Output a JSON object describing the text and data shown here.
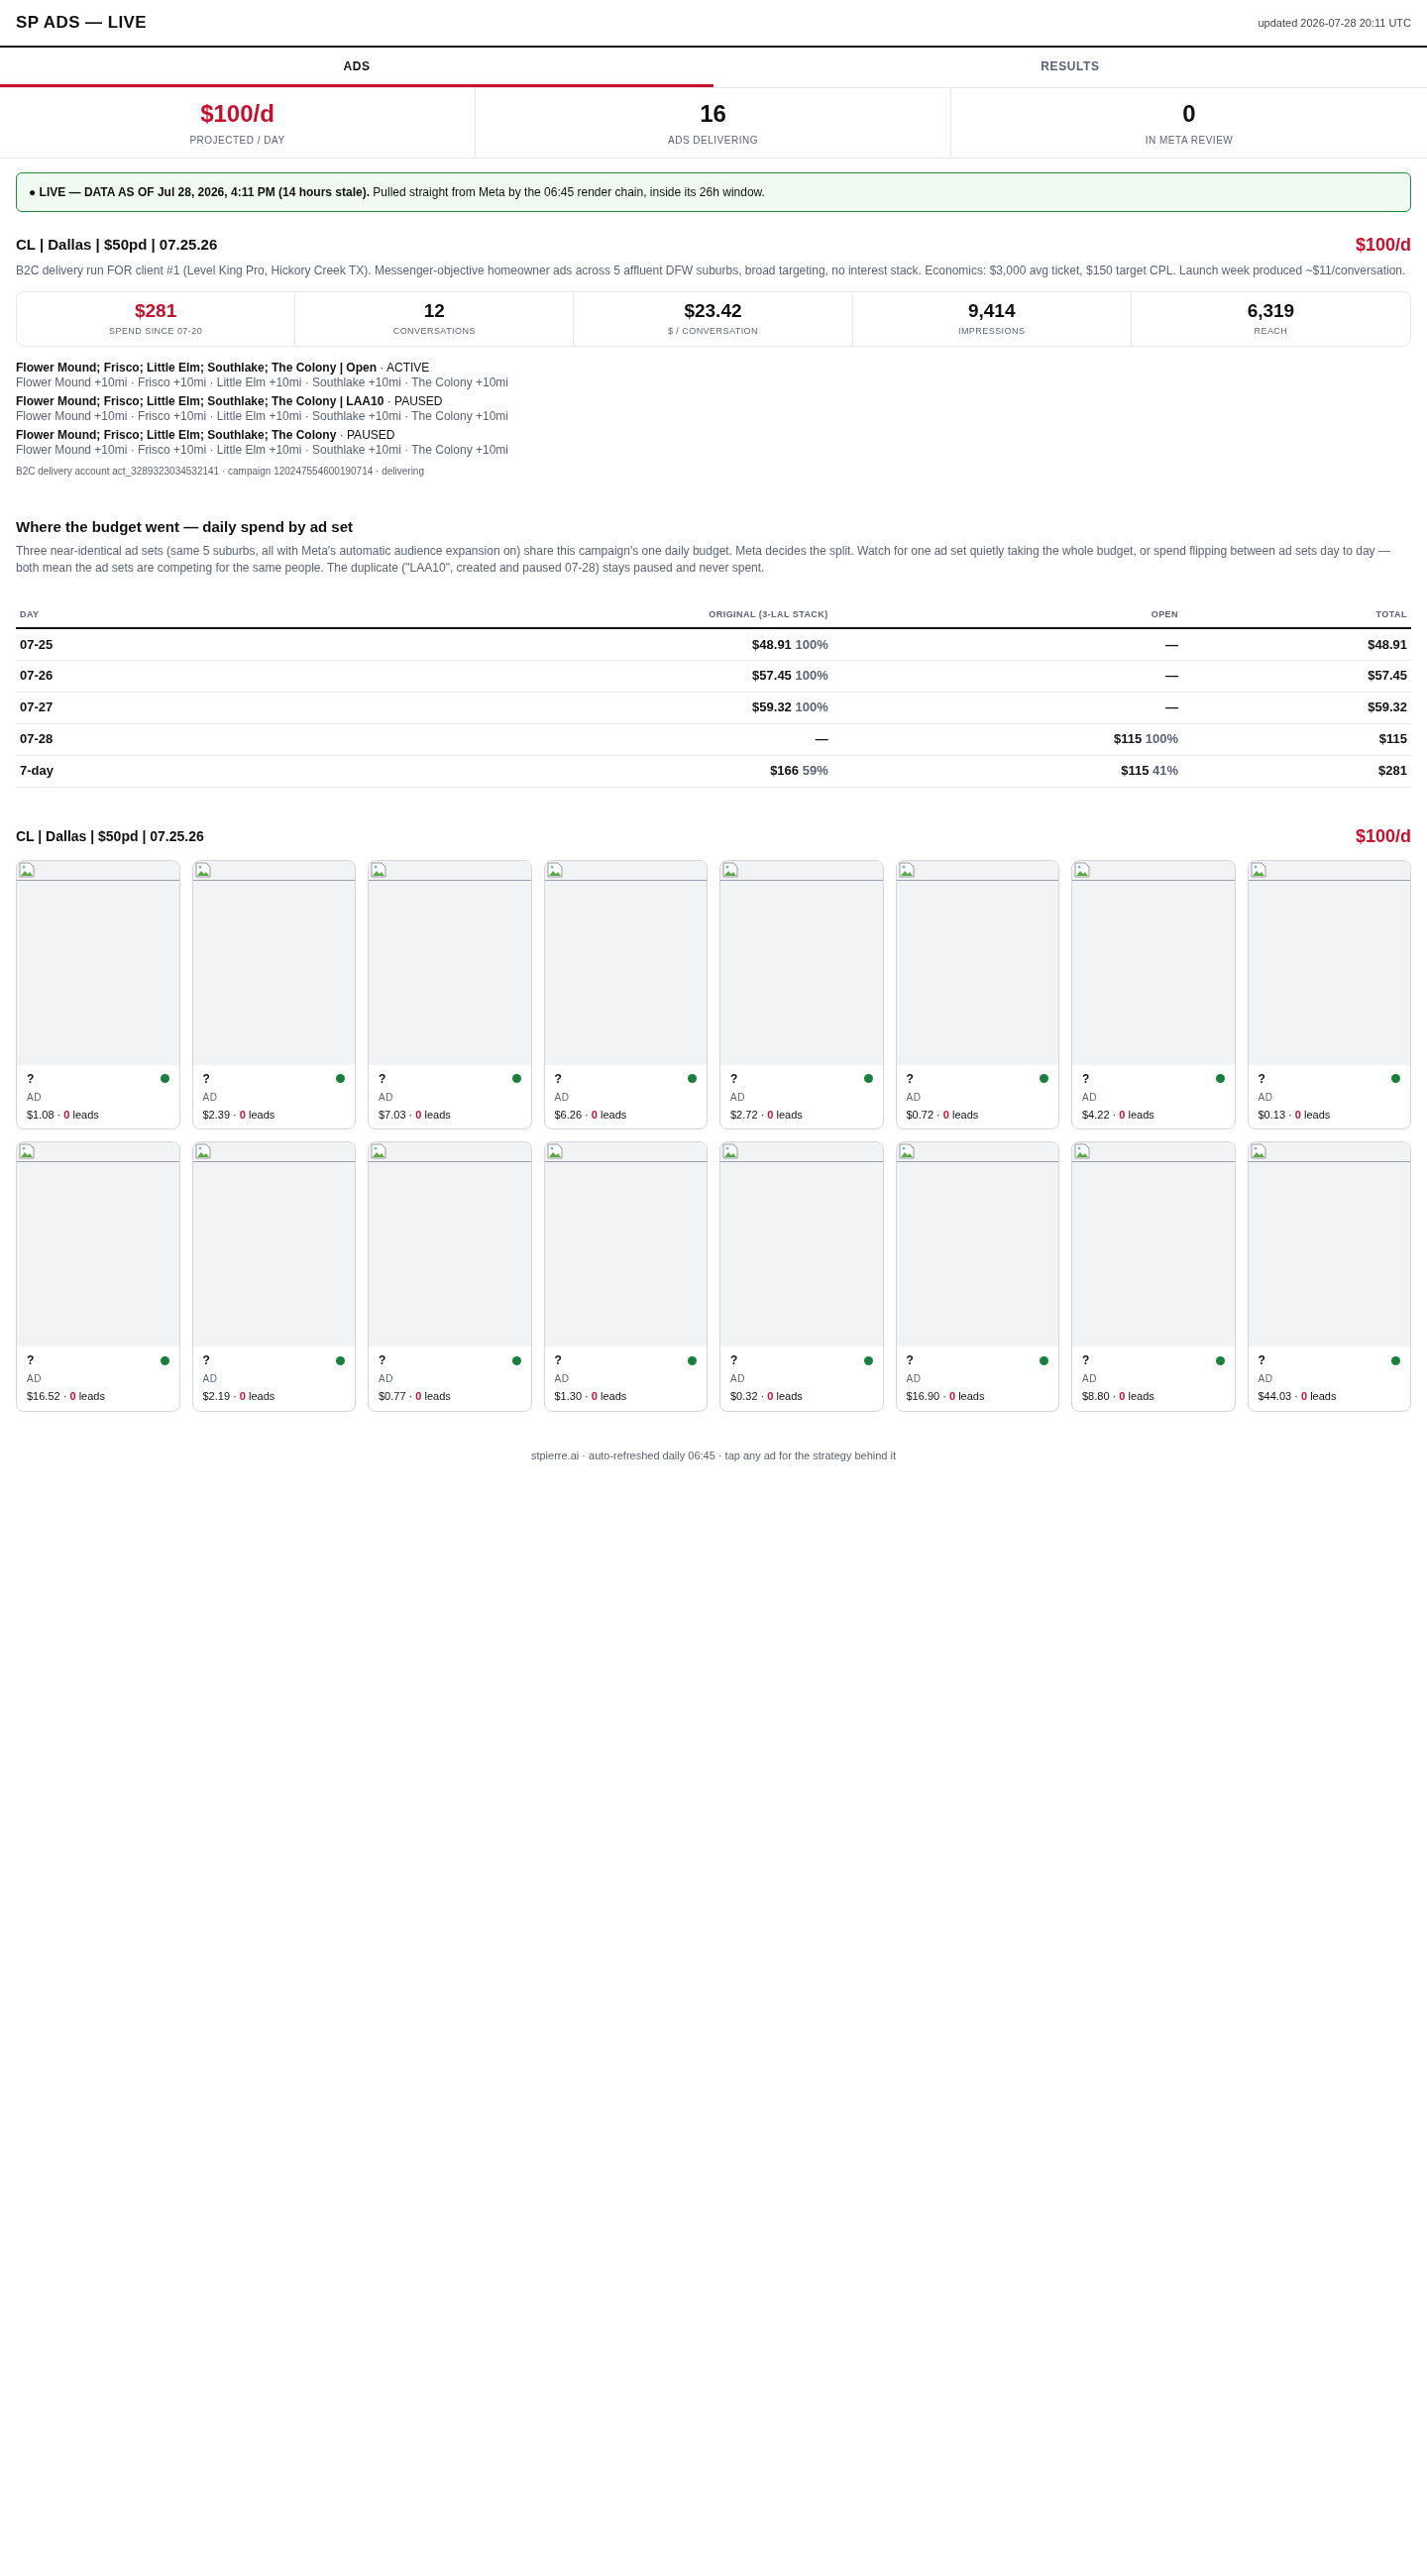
{
  "header": {
    "title": "SP ADS — LIVE",
    "updated": "updated 2026-07-28 20:11 UTC"
  },
  "tabs": [
    {
      "label": "ADS",
      "selected": true
    },
    {
      "label": "RESULTS",
      "selected": false
    }
  ],
  "summary": [
    {
      "value": "$100/d",
      "label": "PROJECTED / DAY",
      "highlight": true
    },
    {
      "value": "16",
      "label": "ADS DELIVERING",
      "highlight": false
    },
    {
      "value": "0",
      "label": "IN META REVIEW",
      "highlight": false
    }
  ],
  "banner": {
    "text": "**● LIVE — DATA AS OF Jul 28, 2026, 4:11 PM (14 hours stale).** Pulled straight from Meta by the 06:45 render chain, inside its 26h window."
  },
  "campaign": {
    "name": "CL | Dallas | $50pd | 07.25.26",
    "budget": "$100/d",
    "description": "B2C delivery run FOR client #1 (Level King Pro, Hickory Creek TX). Messenger-objective homeowner ads across 5 affluent DFW suburbs, broad targeting, no interest stack. Economics: $3,000 avg ticket, $150 target CPL. Launch week produced ~$11/conversation.",
    "stats": [
      {
        "value": "$281",
        "label": "SPEND SINCE 07-20",
        "highlight": true
      },
      {
        "value": "12",
        "label": "CONVERSATIONS",
        "highlight": false
      },
      {
        "value": "$23.42",
        "label": "$ / CONVERSATION",
        "highlight": false
      },
      {
        "value": "9,414",
        "label": "IMPRESSIONS",
        "highlight": false
      },
      {
        "value": "6,319",
        "label": "REACH",
        "highlight": false
      }
    ],
    "ad_sets": [
      {
        "name": "**Flower Mound; Frisco; Little Elm; Southlake; The Colony | Open** · ACTIVE",
        "geo": "Flower Mound +10mi · Frisco +10mi · Little Elm +10mi · Southlake +10mi · The Colony +10mi"
      },
      {
        "name": "**Flower Mound; Frisco; Little Elm; Southlake; The Colony | LAA10** · PAUSED",
        "geo": "Flower Mound +10mi · Frisco +10mi · Little Elm +10mi · Southlake +10mi · The Colony +10mi"
      },
      {
        "name": "**Flower Mound; Frisco; Little Elm; Southlake; The Colony** · PAUSED",
        "geo": "Flower Mound +10mi · Frisco +10mi · Little Elm +10mi · Southlake +10mi · The Colony +10mi"
      }
    ],
    "account": "B2C delivery account act_3289323034532141 · campaign 120247554600190714 · delivering"
  },
  "budget": {
    "title": "Where the budget went — daily spend by ad set",
    "description": "Three near-identical ad sets (same 5 suburbs, all with Meta's automatic audience expansion on) share this campaign's one daily budget. Meta decides the split. Watch for one ad set quietly taking the whole budget, or spend flipping between ad sets day to day — both mean the ad sets are competing for the same people. The duplicate (\"LAA10\", created and paused 07-28) stays paused and never spent.",
    "columns": [
      "DAY",
      "ORIGINAL (3-LAL STACK)",
      "OPEN",
      "TOTAL"
    ],
    "rows": [
      [
        {
          "amount": "07-25"
        },
        {
          "amount": "$48.91",
          "share": "100%"
        },
        {
          "amount": "—"
        },
        {
          "amount": "$48.91"
        }
      ],
      [
        {
          "amount": "07-26"
        },
        {
          "amount": "$57.45",
          "share": "100%"
        },
        {
          "amount": "—"
        },
        {
          "amount": "$57.45"
        }
      ],
      [
        {
          "amount": "07-27"
        },
        {
          "amount": "$59.32",
          "share": "100%"
        },
        {
          "amount": "—"
        },
        {
          "amount": "$59.32"
        }
      ],
      [
        {
          "amount": "07-28"
        },
        {
          "amount": "—"
        },
        {
          "amount": "$115",
          "share": "100%"
        },
        {
          "amount": "$115"
        }
      ],
      [
        {
          "amount": "7-day"
        },
        {
          "amount": "$166",
          "share": "59%"
        },
        {
          "amount": "$115",
          "share": "41%"
        },
        {
          "amount": "$281"
        }
      ]
    ]
  },
  "ads_section": {
    "name": "CL | Dallas | $50pd | 07.25.26",
    "budget": "$100/d",
    "ads": [
      {
        "title": "?",
        "type": "AD",
        "spend": "$1.08 ·",
        "leads": "0",
        "unit": "leads",
        "active": true
      },
      {
        "title": "?",
        "type": "AD",
        "spend": "$2.39 ·",
        "leads": "0",
        "unit": "leads",
        "active": true
      },
      {
        "title": "?",
        "type": "AD",
        "spend": "$7.03 ·",
        "leads": "0",
        "unit": "leads",
        "active": true
      },
      {
        "title": "?",
        "type": "AD",
        "spend": "$6.26 ·",
        "leads": "0",
        "unit": "leads",
        "active": true
      },
      {
        "title": "?",
        "type": "AD",
        "spend": "$2.72 ·",
        "leads": "0",
        "unit": "leads",
        "active": true
      },
      {
        "title": "?",
        "type": "AD",
        "spend": "$0.72 ·",
        "leads": "0",
        "unit": "leads",
        "active": true
      },
      {
        "title": "?",
        "type": "AD",
        "spend": "$4.22 ·",
        "leads": "0",
        "unit": "leads",
        "active": true
      },
      {
        "title": "?",
        "type": "AD",
        "spend": "$0.13 ·",
        "leads": "0",
        "unit": "leads",
        "active": true
      },
      {
        "title": "?",
        "type": "AD",
        "spend": "$16.52 ·",
        "leads": "0",
        "unit": "leads",
        "active": true
      },
      {
        "title": "?",
        "type": "AD",
        "spend": "$2.19 ·",
        "leads": "0",
        "unit": "leads",
        "active": true
      },
      {
        "title": "?",
        "type": "AD",
        "spend": "$0.77 ·",
        "leads": "0",
        "unit": "leads",
        "active": true
      },
      {
        "title": "?",
        "type": "AD",
        "spend": "$1.30 ·",
        "leads": "0",
        "unit": "leads",
        "active": true
      },
      {
        "title": "?",
        "type": "AD",
        "spend": "$0.32 ·",
        "leads": "0",
        "unit": "leads",
        "active": true
      },
      {
        "title": "?",
        "type": "AD",
        "spend": "$16.90 ·",
        "leads": "0",
        "unit": "leads",
        "active": true
      },
      {
        "title": "?",
        "type": "AD",
        "spend": "$8.80 ·",
        "leads": "0",
        "unit": "leads",
        "active": true
      },
      {
        "title": "?",
        "type": "AD",
        "spend": "$44.03 ·",
        "leads": "0",
        "unit": "leads",
        "active": true
      }
    ]
  },
  "footer": "stpierre.ai · auto-refreshed daily 06:45 · tap any ad for the strategy behind it"
}
